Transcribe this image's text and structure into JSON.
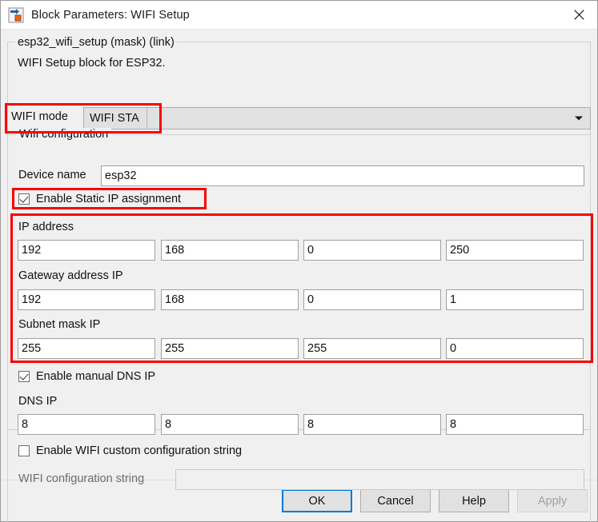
{
  "window": {
    "title": "Block Parameters: WIFI Setup",
    "icon": "simulink-block-icon",
    "close_icon": "close-icon"
  },
  "description": {
    "mask_line": "esp32_wifi_setup (mask) (link)",
    "summary": "WIFI Setup block for ESP32."
  },
  "wifi_mode": {
    "label": "WIFI mode",
    "value": "WIFI STA",
    "arrow_icon": "chevron-down-icon"
  },
  "wifi_configuration": {
    "legend": "Wifi configuration",
    "device_name": {
      "label": "Device name",
      "value": "esp32"
    },
    "static_ip": {
      "label": "Enable Static IP assignment",
      "checked": true
    },
    "ip_address": {
      "label": "IP address",
      "octets": [
        "192",
        "168",
        "0",
        "250"
      ]
    },
    "gateway": {
      "label": "Gateway address IP",
      "octets": [
        "192",
        "168",
        "0",
        "1"
      ]
    },
    "subnet": {
      "label": "Subnet mask IP",
      "octets": [
        "255",
        "255",
        "255",
        "0"
      ]
    },
    "manual_dns": {
      "label": "Enable manual DNS IP",
      "checked": true
    },
    "dns_ip": {
      "label": "DNS IP",
      "octets": [
        "8",
        "8",
        "8",
        "8"
      ]
    },
    "custom_config": {
      "label": "Enable WIFI custom configuration string",
      "checked": false
    },
    "config_string": {
      "label": "WIFI configuration string",
      "value": "",
      "enabled": false
    }
  },
  "footer": {
    "ok": "OK",
    "cancel": "Cancel",
    "help": "Help",
    "apply": "Apply",
    "apply_enabled": false
  },
  "colors": {
    "annotation": "#f90000",
    "focus": "#0078d7",
    "dialog_bg": "#f0f0f0"
  }
}
